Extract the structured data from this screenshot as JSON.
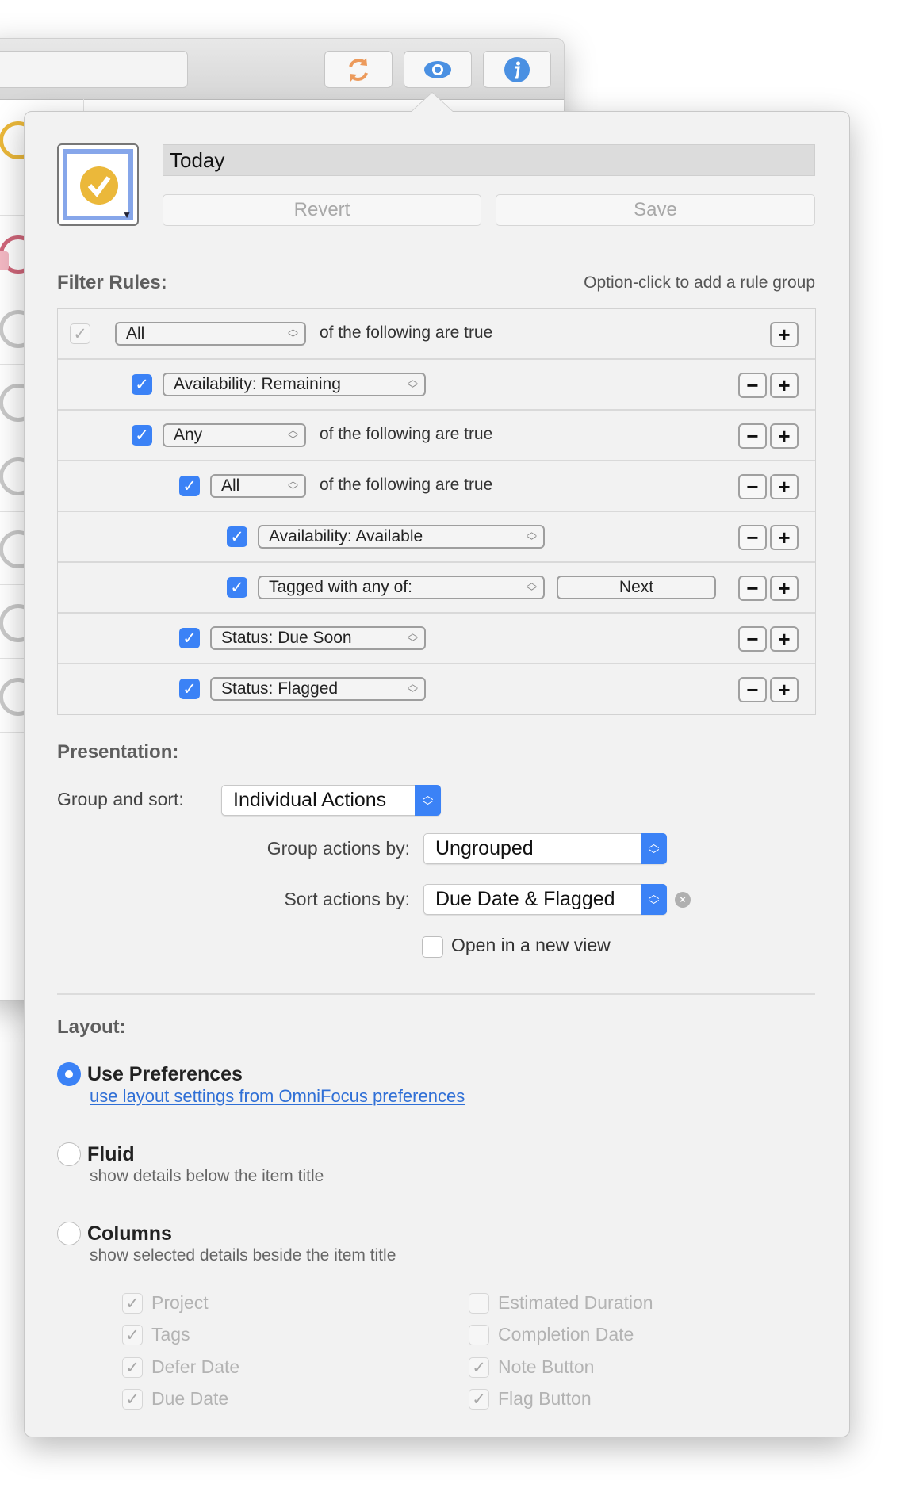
{
  "toolbar": {
    "buttons": [
      {
        "icon": "sync-icon",
        "color": "#ec9a5b"
      },
      {
        "icon": "eye-icon",
        "color": "#4a90e2"
      },
      {
        "icon": "info-icon",
        "color": "#4a90e2"
      }
    ]
  },
  "perspective": {
    "icon": "check-circle-icon",
    "icon_color": "#ebb83a",
    "name": "Today",
    "revert_label": "Revert",
    "save_label": "Save"
  },
  "filter_rules": {
    "heading": "Filter Rules:",
    "hint": "Option-click to add a rule group",
    "rows": [
      {
        "checked": true,
        "enabled": false,
        "popup": "All",
        "suffix": "of the following are true",
        "minus": false
      },
      {
        "checked": true,
        "enabled": true,
        "popup": "Availability: Remaining",
        "suffix": "",
        "minus": true
      },
      {
        "checked": true,
        "enabled": true,
        "popup": "Any",
        "suffix": "of the following are true",
        "minus": true
      },
      {
        "checked": true,
        "enabled": true,
        "popup": "All",
        "suffix": "of the following are true",
        "minus": true
      },
      {
        "checked": true,
        "enabled": true,
        "popup": "Availability: Available",
        "suffix": "",
        "minus": true
      },
      {
        "checked": true,
        "enabled": true,
        "popup": "Tagged with any of:",
        "suffix": "",
        "token": "Next",
        "minus": true
      },
      {
        "checked": true,
        "enabled": true,
        "popup": "Status: Due Soon",
        "suffix": "",
        "minus": true
      },
      {
        "checked": true,
        "enabled": true,
        "popup": "Status: Flagged",
        "suffix": "",
        "minus": true
      }
    ]
  },
  "presentation": {
    "heading": "Presentation:",
    "group_and_sort_label": "Group and sort:",
    "group_and_sort_value": "Individual Actions",
    "group_by_label": "Group actions by:",
    "group_by_value": "Ungrouped",
    "sort_by_label": "Sort actions by:",
    "sort_by_value": "Due Date & Flagged",
    "open_new_view_label": "Open in a new view",
    "open_new_view_checked": false
  },
  "layout": {
    "heading": "Layout:",
    "options": [
      {
        "label": "Use Preferences",
        "desc": "use layout settings from OmniFocus preferences",
        "selected": true,
        "is_link": true
      },
      {
        "label": "Fluid",
        "desc": "show details below the item title",
        "selected": false
      },
      {
        "label": "Columns",
        "desc": "show selected details beside the item title",
        "selected": false
      }
    ],
    "columns_left": [
      {
        "label": "Project",
        "checked": true
      },
      {
        "label": "Tags",
        "checked": true
      },
      {
        "label": "Defer Date",
        "checked": true
      },
      {
        "label": "Due Date",
        "checked": true
      }
    ],
    "columns_right": [
      {
        "label": "Estimated Duration",
        "checked": false
      },
      {
        "label": "Completion Date",
        "checked": false
      },
      {
        "label": "Note Button",
        "checked": true
      },
      {
        "label": "Flag Button",
        "checked": true
      }
    ]
  },
  "colors": {
    "accent": "#3b82f6",
    "link": "#2f6fd6",
    "background": "#f2f2f2"
  }
}
